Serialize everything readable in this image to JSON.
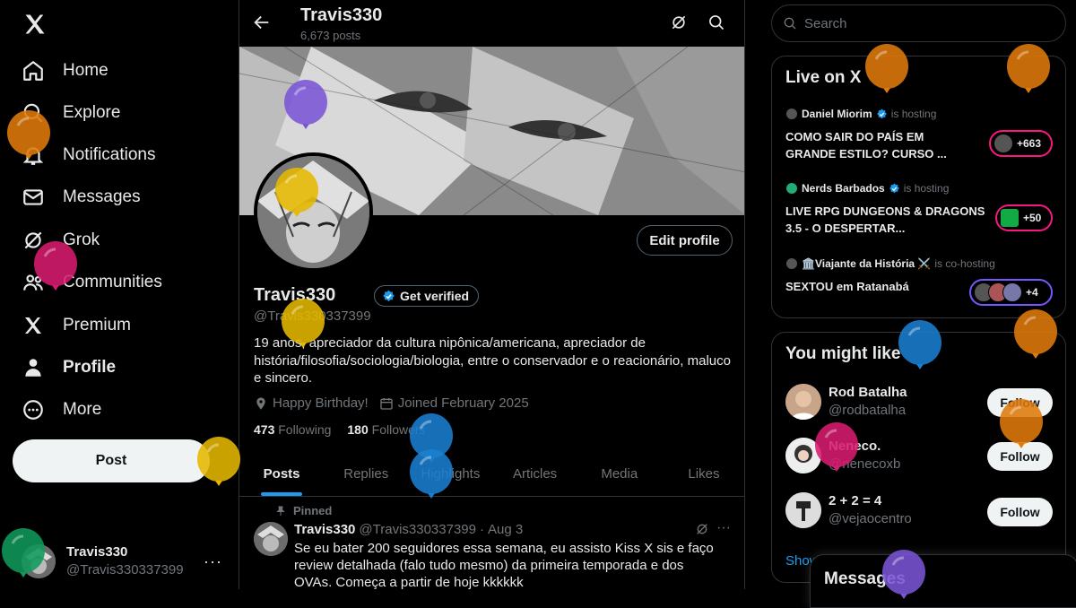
{
  "nav": {
    "items": [
      {
        "label": "Home",
        "icon": "home-icon"
      },
      {
        "label": "Explore",
        "icon": "search-icon"
      },
      {
        "label": "Notifications",
        "icon": "bell-icon"
      },
      {
        "label": "Messages",
        "icon": "envelope-icon"
      },
      {
        "label": "Grok",
        "icon": "grok-icon"
      },
      {
        "label": "Communities",
        "icon": "people-icon"
      },
      {
        "label": "Premium",
        "icon": "x-logo-icon"
      },
      {
        "label": "Profile",
        "icon": "person-icon"
      },
      {
        "label": "More",
        "icon": "more-circle-icon"
      }
    ],
    "post_label": "Post"
  },
  "account": {
    "name": "Travis330",
    "handle": "@Travis330337399",
    "more": "···"
  },
  "topbar": {
    "name": "Travis330",
    "posts": "6,673 posts"
  },
  "profile": {
    "edit_label": "Edit profile",
    "name": "Travis330",
    "verify_label": "Get verified",
    "handle": "@Travis330337399",
    "bio": "19 anos, apreciador da cultura nipônica/americana, apreciador de história/filosofia/sociologia/biologia, entre o conservador e o reacionário, maluco e sincero.",
    "birthday": "Happy Birthday!",
    "joined": "Joined February 2025",
    "following_count": "473",
    "following_label": "Following",
    "followers_count": "180",
    "followers_label": "Followers"
  },
  "tabs": [
    "Posts",
    "Replies",
    "Highlights",
    "Articles",
    "Media",
    "Likes"
  ],
  "tweet": {
    "pinned_label": "Pinned",
    "name": "Travis330",
    "handle": "@Travis330337399",
    "sep": "·",
    "date": "Aug 3",
    "text": "Se eu bater 200 seguidores essa semana, eu assisto Kiss X sis e faço review detalhada (falo tudo mesmo) da primeira temporada e dos OVAs. Começa a partir de hoje kkkkkk"
  },
  "search": {
    "placeholder": "Search"
  },
  "live": {
    "title": "Live on X",
    "items": [
      {
        "host": "Daniel Miorim",
        "status": "is hosting",
        "title": "COMO SAIR DO PAÍS EM GRANDE ESTILO? CURSO ...",
        "count": "+663"
      },
      {
        "host": "Nerds Barbados",
        "status": "is hosting",
        "title": "LIVE RPG DUNGEONS & DRAGONS 3.5 - O DESPERTAR...",
        "count": "+50"
      },
      {
        "host": "🏛️Viajante da História ⚔️",
        "status": "is co-hosting",
        "title": "SEXTOU em Ratanabá",
        "count": "+4"
      }
    ]
  },
  "suggest": {
    "title": "You might like",
    "follow_label": "Follow",
    "items": [
      {
        "name": "Rod Batalha",
        "handle": "@rodbatalha"
      },
      {
        "name": "Neneco.",
        "handle": "@nenecoxb"
      },
      {
        "name": "2 + 2 = 4",
        "handle": "@vejaocentro"
      }
    ],
    "show_more": "Show more"
  },
  "messages_drawer": {
    "title": "Messages"
  },
  "colors": {
    "accent": "#1d9bf0",
    "verified": "#1d9bf0",
    "live_pink": "#f91880",
    "live_purple": "#7856ff",
    "background": "#000000"
  },
  "balloons": [
    "orange",
    "orange",
    "orange",
    "purple",
    "yellow",
    "pink",
    "yellow",
    "yellow",
    "blue",
    "blue",
    "blue",
    "orange",
    "orange",
    "pink",
    "green",
    "purple"
  ]
}
